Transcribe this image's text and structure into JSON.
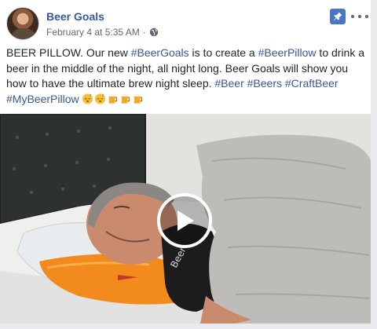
{
  "post": {
    "page_name": "Beer Goals",
    "timestamp": "February 4 at 5:35 AM",
    "separator": "·",
    "privacy_icon": "globe-icon",
    "pin_icon": "pin-icon",
    "more_icon": "more-options-icon",
    "text_parts": {
      "p1": "BEER PILLOW. Our new ",
      "t1": "#BeerGoals",
      "p2": " is to create a ",
      "t2": "#BeerPillow",
      "p3": " to drink a beer in the middle of the night, all night long. Beer Goals will show you how to have the ultimate brew night sleep. ",
      "t3": "#Beer",
      "p4": " ",
      "t4": "#Beers",
      "p5": " ",
      "t5": "#CraftBeer",
      "p6": " ",
      "t6": "#MyBeerPillow"
    },
    "emojis": [
      "sleeping-face-emoji",
      "sleeping-face-emoji",
      "beer-mug-emoji",
      "beer-mug-emoji",
      "beer-mug-emoji"
    ]
  },
  "video": {
    "shirt_text": "Beer",
    "play_icon": "play-icon"
  },
  "colors": {
    "link": "#385898",
    "meta": "#616770",
    "pin_bg": "#4a76c6"
  }
}
